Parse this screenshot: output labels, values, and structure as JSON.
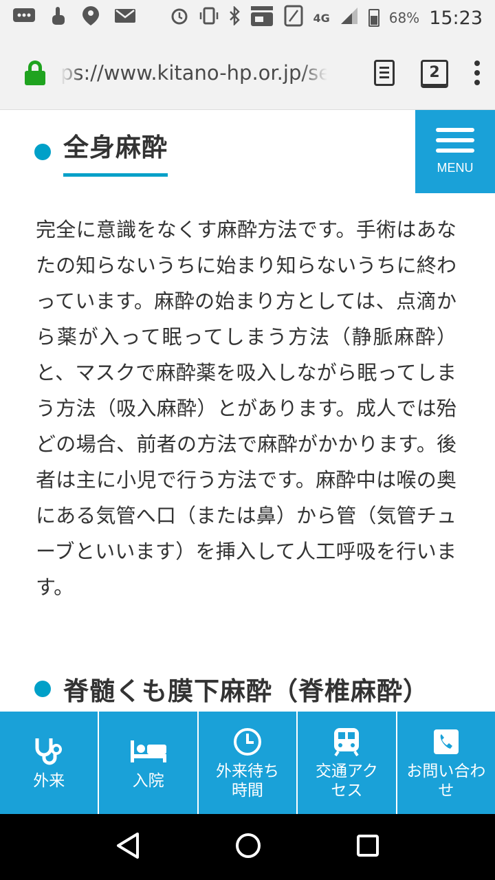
{
  "status_bar": {
    "network": "4G",
    "battery": "68%",
    "time": "15:23"
  },
  "browser": {
    "url": "ps://www.kitano-hp.or.jp/se",
    "tab_count": "2"
  },
  "menu": {
    "label": "MENU"
  },
  "section1": {
    "title": "全身麻酔",
    "body": "完全に意識をなくす麻酔方法です。手術はあなたの知らないうちに始まり知らないうちに終わっています。麻酔の始まり方としては、点滴から薬が入って眠ってしまう方法（静脈麻酔）と、マスクで麻酔薬を吸入しながら眠ってしまう方法（吸入麻酔）とがあります。成人では殆どの場合、前者の方法で麻酔がかかります。後者は主に小児で行う方法です。麻酔中は喉の奥にある気管へ口（または鼻）から管（気管チューブといいます）を挿入して人工呼吸を行います。"
  },
  "section2": {
    "title": "脊髄くも膜下麻酔（脊椎麻酔）"
  },
  "bottom_nav": {
    "items": [
      {
        "label": "外来",
        "icon": "stethoscope-icon"
      },
      {
        "label": "入院",
        "icon": "bed-icon"
      },
      {
        "label": "外来待ち時間",
        "icon": "clock-icon"
      },
      {
        "label": "交通アクセス",
        "icon": "train-icon"
      },
      {
        "label": "お問い合わせ",
        "icon": "phone-icon"
      }
    ]
  },
  "colors": {
    "accent": "#00a0c8",
    "nav_background": "#1aa1d8",
    "lock_green": "#1fa31f"
  }
}
